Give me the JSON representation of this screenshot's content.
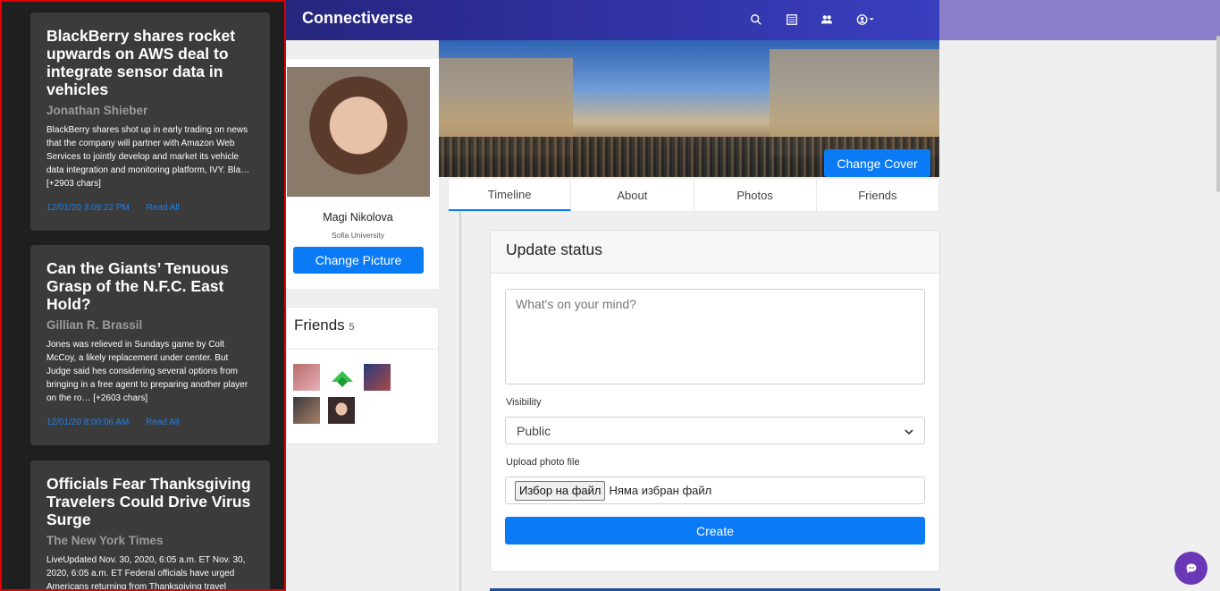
{
  "app": {
    "brand": "Connectiverse"
  },
  "nav": {
    "icons": [
      "search-icon",
      "newspaper-icon",
      "people-icon",
      "account-icon"
    ]
  },
  "news": [
    {
      "title": "BlackBerry shares rocket upwards on AWS deal to integrate sensor data in vehicles",
      "author": "Jonathan Shieber",
      "text": "BlackBerry shares shot up in early trading on news that the company will partner with Amazon Web Services to jointly develop and market its vehicle data integration and monitoring platform, IVY. Bla… [+2903 chars]",
      "date": "12/01/20 3:09:22 PM",
      "read": "Read All"
    },
    {
      "title": "Can the Giants’ Tenuous Grasp of the N.F.C. East Hold?",
      "author": "Gillian R. Brassil",
      "text": "Jones was relieved in Sundays game by Colt McCoy, a likely replacement under center. But Judge said hes considering several options from bringing in a free agent to preparing another player on the ro… [+2603 chars]",
      "date": "12/01/20 8:00:06 AM",
      "read": "Read All"
    },
    {
      "title": "Officials Fear Thanksgiving Travelers Could Drive Virus Surge",
      "author": "The New York Times",
      "text": "LiveUpdated Nov. 30, 2020, 6:05 a.m. ET Nov. 30, 2020, 6:05 a.m. ET Federal officials have urged Americans returning from Thanksgiving travel",
      "date": "",
      "read": ""
    }
  ],
  "profile": {
    "name": "Magi Nikolova",
    "school": "Sofia University",
    "change_picture": "Change Picture",
    "change_cover": "Change Cover"
  },
  "friends": {
    "title": "Friends",
    "count": "5"
  },
  "tabs": [
    "Timeline",
    "About",
    "Photos",
    "Friends"
  ],
  "status": {
    "title": "Update status",
    "placeholder": "What's on your mind?",
    "visibility_label": "Visibility",
    "visibility_value": "Public",
    "upload_label": "Upload photo file",
    "file_button": "Избор на файл",
    "file_status": "Няма избран файл",
    "create": "Create"
  },
  "colors": {
    "accent": "#0b7bf5",
    "sidebar_border": "#e00000",
    "chat": "#6a38b5"
  }
}
